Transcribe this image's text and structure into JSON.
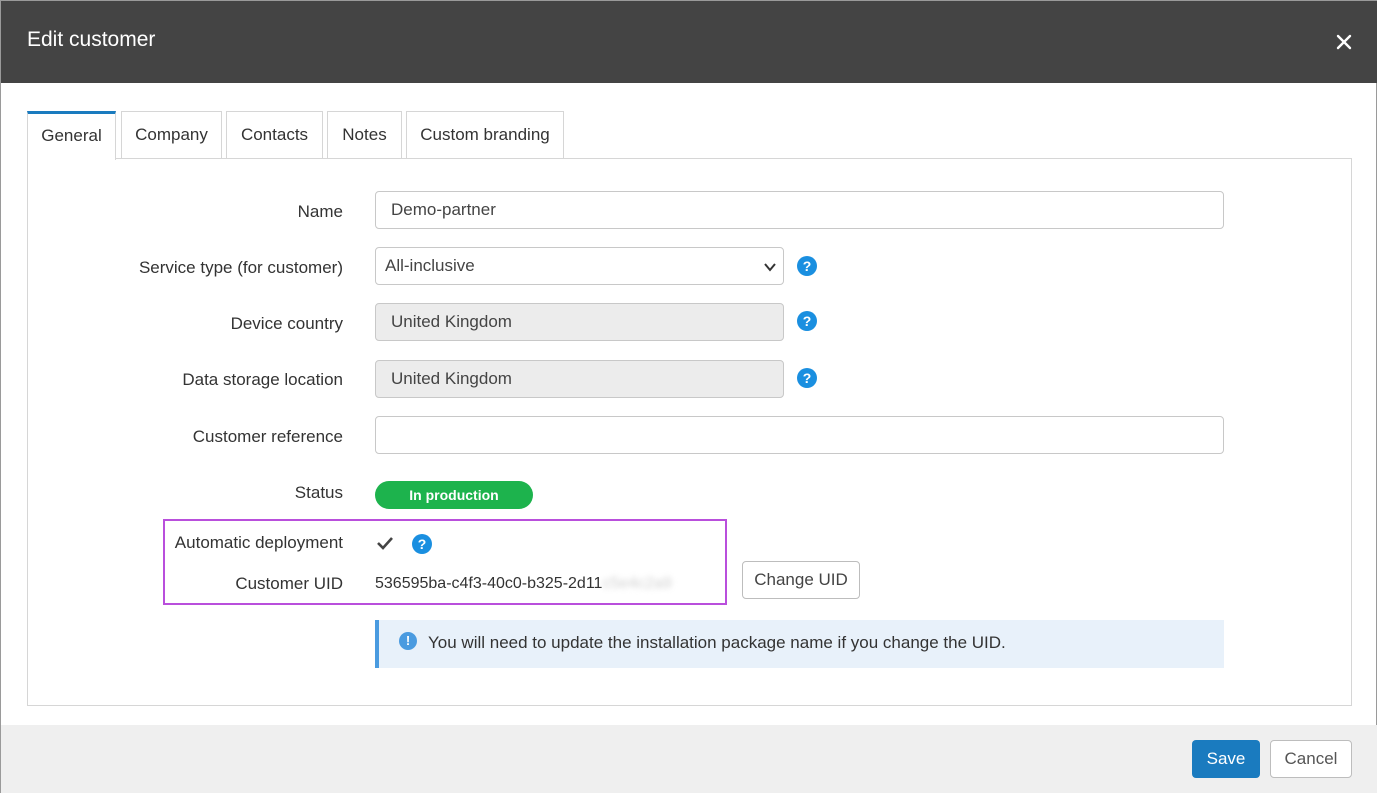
{
  "dialog": {
    "title": "Edit customer",
    "close_icon": "close-icon"
  },
  "tabs": [
    {
      "label": "General",
      "active": true
    },
    {
      "label": "Company",
      "active": false
    },
    {
      "label": "Contacts",
      "active": false
    },
    {
      "label": "Notes",
      "active": false
    },
    {
      "label": "Custom branding",
      "active": false
    }
  ],
  "form": {
    "name": {
      "label": "Name",
      "value": "Demo-partner"
    },
    "service_type": {
      "label": "Service type (for customer)",
      "value": "All-inclusive",
      "help_icon": "help-icon"
    },
    "device_country": {
      "label": "Device country",
      "value": "United Kingdom",
      "help_icon": "help-icon"
    },
    "data_storage": {
      "label": "Data storage location",
      "value": "United Kingdom",
      "help_icon": "help-icon"
    },
    "customer_reference": {
      "label": "Customer reference",
      "value": ""
    },
    "status": {
      "label": "Status",
      "value": "In production",
      "color": "#1db34d"
    },
    "automatic_deployment": {
      "label": "Automatic deployment",
      "checked": true,
      "help_icon": "help-icon"
    },
    "customer_uid": {
      "label": "Customer UID",
      "value": "536595ba-c4f3-40c0-b325-2d11",
      "redacted_suffix": "c5e4c2a9",
      "change_label": "Change UID"
    }
  },
  "info": {
    "icon": "info-icon",
    "text": "You will need to update the installation package name if you change the UID."
  },
  "footer": {
    "save_label": "Save",
    "cancel_label": "Cancel"
  },
  "colors": {
    "header": "#444444",
    "accent": "#1a7bbf",
    "help": "#1a8fe0",
    "highlight": "#b94fdc",
    "status": "#1db34d"
  }
}
